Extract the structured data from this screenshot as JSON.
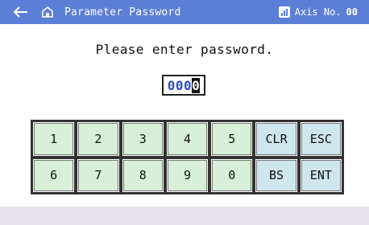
{
  "header": {
    "back_icon": "back-arrow-icon",
    "home_icon": "home-icon",
    "title": "Parameter Password",
    "axis_label": "Axis No.",
    "axis_number": "00",
    "axis_icon": "axis-icon",
    "bar_color": "#5b7fd6"
  },
  "prompt": "Please enter password.",
  "password_field": {
    "value": "000",
    "cursor_char": "0"
  },
  "keypad": {
    "row1": [
      "1",
      "2",
      "3",
      "4",
      "5",
      "CLR",
      "ESC"
    ],
    "row2": [
      "6",
      "7",
      "8",
      "9",
      "0",
      "BS",
      "ENT"
    ],
    "number_key_color": "#d7f0d7",
    "function_key_color": "#cfe6ee"
  }
}
